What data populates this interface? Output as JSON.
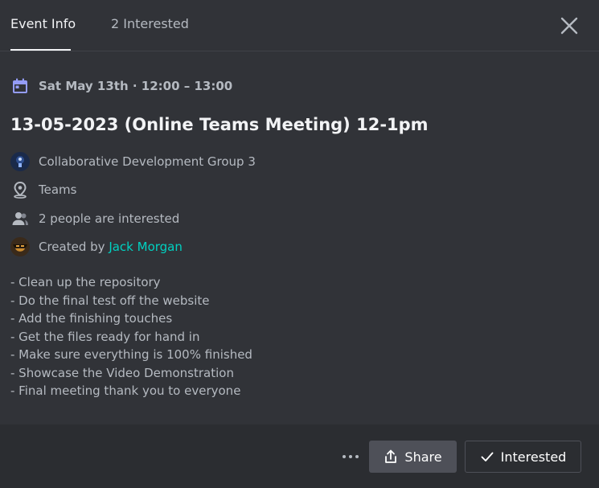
{
  "header": {
    "tabs": [
      {
        "label": "Event Info",
        "active": true
      },
      {
        "label": "2 Interested",
        "active": false
      }
    ],
    "close_icon": "close-icon"
  },
  "event": {
    "date": "Sat May 13th · 12:00 – 13:00",
    "title": "13-05-2023 (Online Teams Meeting) 12-1pm",
    "guild": "Collaborative Development Group 3",
    "location": "Teams",
    "interested": "2 people are interested",
    "created_by_prefix": "Created by ",
    "creator": "Jack Morgan",
    "description": [
      "- Clean up the repository",
      "- Do the final test off the website",
      "- Add the finishing touches",
      "- Get the files ready for hand in",
      "- Make sure everything is 100% finished",
      "- Showcase the Video Demonstration",
      "- Final meeting thank you to everyone"
    ]
  },
  "footer": {
    "share_label": "Share",
    "interested_label": "Interested"
  },
  "colors": {
    "background": "#313338",
    "footer": "#2b2d31",
    "accent_calendar": "#949cf7",
    "link": "#00d1c1",
    "share_button": "#4e5058"
  }
}
